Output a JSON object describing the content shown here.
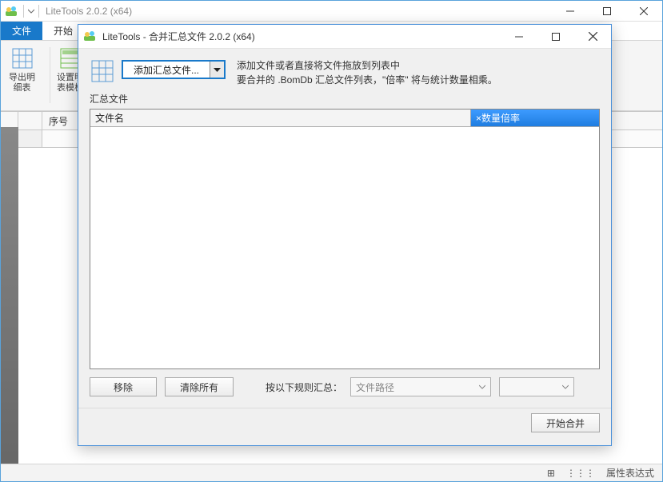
{
  "main_window": {
    "title": "LiteTools 2.0.2 (x64)",
    "tabs": {
      "file": "文件",
      "start": "开始"
    },
    "ribbon": {
      "export_detail": "导出明\n细表",
      "set_table": "设置明\n表模板"
    },
    "grid": {
      "col_seq": "序号"
    },
    "statusbar": {
      "props": "属性表达式"
    }
  },
  "dialog": {
    "title": "LiteTools - 合并汇总文件 2.0.2 (x64)",
    "add_combo": "添加汇总文件...",
    "hint1": "添加文件或者直接将文件拖放到列表中",
    "hint2": "要合并的 .BomDb 汇总文件列表，\"倍率\" 将与统计数量相乘。",
    "section_label": "汇总文件",
    "col_filename": "文件名",
    "col_rate": "×数量倍率",
    "btn_remove": "移除",
    "btn_clear": "清除所有",
    "rule_label": "按以下规则汇总：",
    "rule_combo": "文件路径",
    "btn_start": "开始合并"
  }
}
